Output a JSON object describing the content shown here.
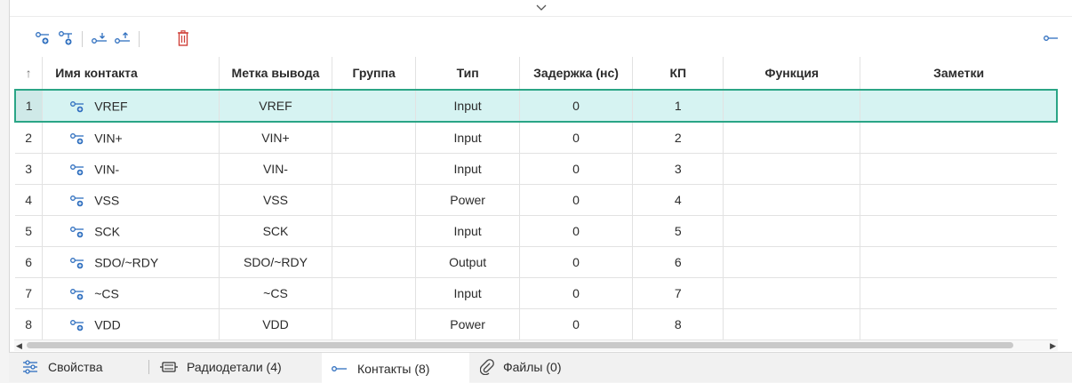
{
  "table": {
    "headers": {
      "num_sort": "↑",
      "name": "Имя контакта",
      "label": "Метка вывода",
      "group": "Группа",
      "type": "Тип",
      "delay": "Задержка (нс)",
      "pad": "КП",
      "function": "Функция",
      "notes": "Заметки"
    },
    "rows": [
      {
        "num": "1",
        "name": "VREF",
        "label": "VREF",
        "group": "",
        "type": "Input",
        "delay": "0",
        "pad": "1",
        "function": "",
        "notes": ""
      },
      {
        "num": "2",
        "name": "VIN+",
        "label": "VIN+",
        "group": "",
        "type": "Input",
        "delay": "0",
        "pad": "2",
        "function": "",
        "notes": ""
      },
      {
        "num": "3",
        "name": "VIN-",
        "label": "VIN-",
        "group": "",
        "type": "Input",
        "delay": "0",
        "pad": "3",
        "function": "",
        "notes": ""
      },
      {
        "num": "4",
        "name": "VSS",
        "label": "VSS",
        "group": "",
        "type": "Power",
        "delay": "0",
        "pad": "4",
        "function": "",
        "notes": ""
      },
      {
        "num": "5",
        "name": "SCK",
        "label": "SCK",
        "group": "",
        "type": "Input",
        "delay": "0",
        "pad": "5",
        "function": "",
        "notes": ""
      },
      {
        "num": "6",
        "name": "SDO/~RDY",
        "label": "SDO/~RDY",
        "group": "",
        "type": "Output",
        "delay": "0",
        "pad": "6",
        "function": "",
        "notes": ""
      },
      {
        "num": "7",
        "name": "~CS",
        "label": "~CS",
        "group": "",
        "type": "Input",
        "delay": "0",
        "pad": "7",
        "function": "",
        "notes": ""
      },
      {
        "num": "8",
        "name": "VDD",
        "label": "VDD",
        "group": "",
        "type": "Power",
        "delay": "0",
        "pad": "8",
        "function": "",
        "notes": ""
      }
    ],
    "selected_row": "1"
  },
  "tabs": {
    "properties": "Свойства",
    "components": "Радиодетали (4)",
    "contacts": "Контакты (8)",
    "files": "Файлы (0)",
    "active": "Контакты (8)"
  },
  "colors": {
    "accent": "#2aa586",
    "selection_bg": "#d6f3f2",
    "delete": "#d0423a",
    "icon": "#2f6fbf"
  },
  "icons": {
    "collapse": "chevron-down-icon",
    "add_pin": "add-pin-icon",
    "add_pin_below": "add-pin-below-icon",
    "import_pins": "import-pins-icon",
    "export_pins": "export-pins-icon",
    "delete": "trash-icon",
    "pin_mode": "pin-icon"
  }
}
